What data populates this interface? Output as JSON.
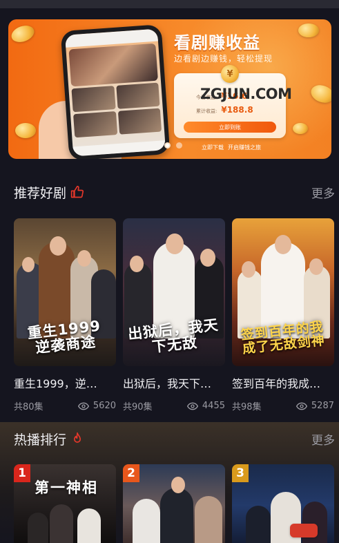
{
  "banner": {
    "title": "看剧赚收益",
    "subtitle": "边看剧边赚钱，轻松提现",
    "today_label": "今日收益:",
    "today_value": "¥16.6",
    "total_label": "累计收益:",
    "total_value": "¥188.8",
    "withdraw_label": "立即到账",
    "download_label": "立即下载",
    "journey_label": "开启赚钱之旅",
    "watermark": "ZGJUN.COM",
    "coin_symbol": "¥"
  },
  "recommend": {
    "title": "推荐好剧",
    "more": "更多",
    "icon": "thumbs-up-icon",
    "items": [
      {
        "poster_text": "重生1999 逆袭商途",
        "title": "重生1999，逆…",
        "episodes": "共80集",
        "views": "5620"
      },
      {
        "poster_text": "出狱后，我天下无敌",
        "title": "出狱后，我天下…",
        "episodes": "共90集",
        "views": "4455"
      },
      {
        "poster_text": "签到百年的我成了无敌剑神",
        "title": "签到百年的我成…",
        "episodes": "共98集",
        "views": "5287"
      }
    ]
  },
  "hot": {
    "title": "热播排行",
    "more": "更多",
    "icon": "flame-icon",
    "items": [
      {
        "rank": "1",
        "poster_text": "第一神相",
        "rank_color": "#d9261c"
      },
      {
        "rank": "2",
        "poster_text": "",
        "rank_color": "#e8571c"
      },
      {
        "rank": "3",
        "poster_text": "",
        "rank_color": "#d99a1c"
      }
    ]
  },
  "colors": {
    "background": "#15151f",
    "accent_red": "#e5372a",
    "banner_orange": "#f26a12"
  }
}
